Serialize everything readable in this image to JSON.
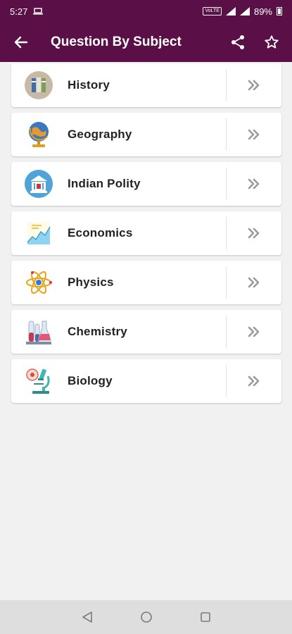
{
  "status_bar": {
    "time": "5:27",
    "network_badge": "VoLTE",
    "battery_percent": "89%"
  },
  "app_bar": {
    "title": "Question By Subject",
    "icons": [
      "back-arrow-icon",
      "share-icon",
      "star-icon"
    ]
  },
  "subjects": [
    {
      "label": "History",
      "icon": "books-icon"
    },
    {
      "label": "Geography",
      "icon": "globe-icon"
    },
    {
      "label": "Indian Polity",
      "icon": "parliament-icon"
    },
    {
      "label": "Economics",
      "icon": "growth-chart-icon"
    },
    {
      "label": "Physics",
      "icon": "atom-icon"
    },
    {
      "label": "Chemistry",
      "icon": "test-tubes-icon"
    },
    {
      "label": "Biology",
      "icon": "microscope-icon"
    }
  ],
  "colors": {
    "primary": "#5a1047",
    "background": "#f1f1f1",
    "card": "#ffffff",
    "arrow": "#9a9a9a"
  },
  "nav_bar": {
    "icons": [
      "back-triangle-icon",
      "home-circle-icon",
      "recents-square-icon"
    ]
  }
}
